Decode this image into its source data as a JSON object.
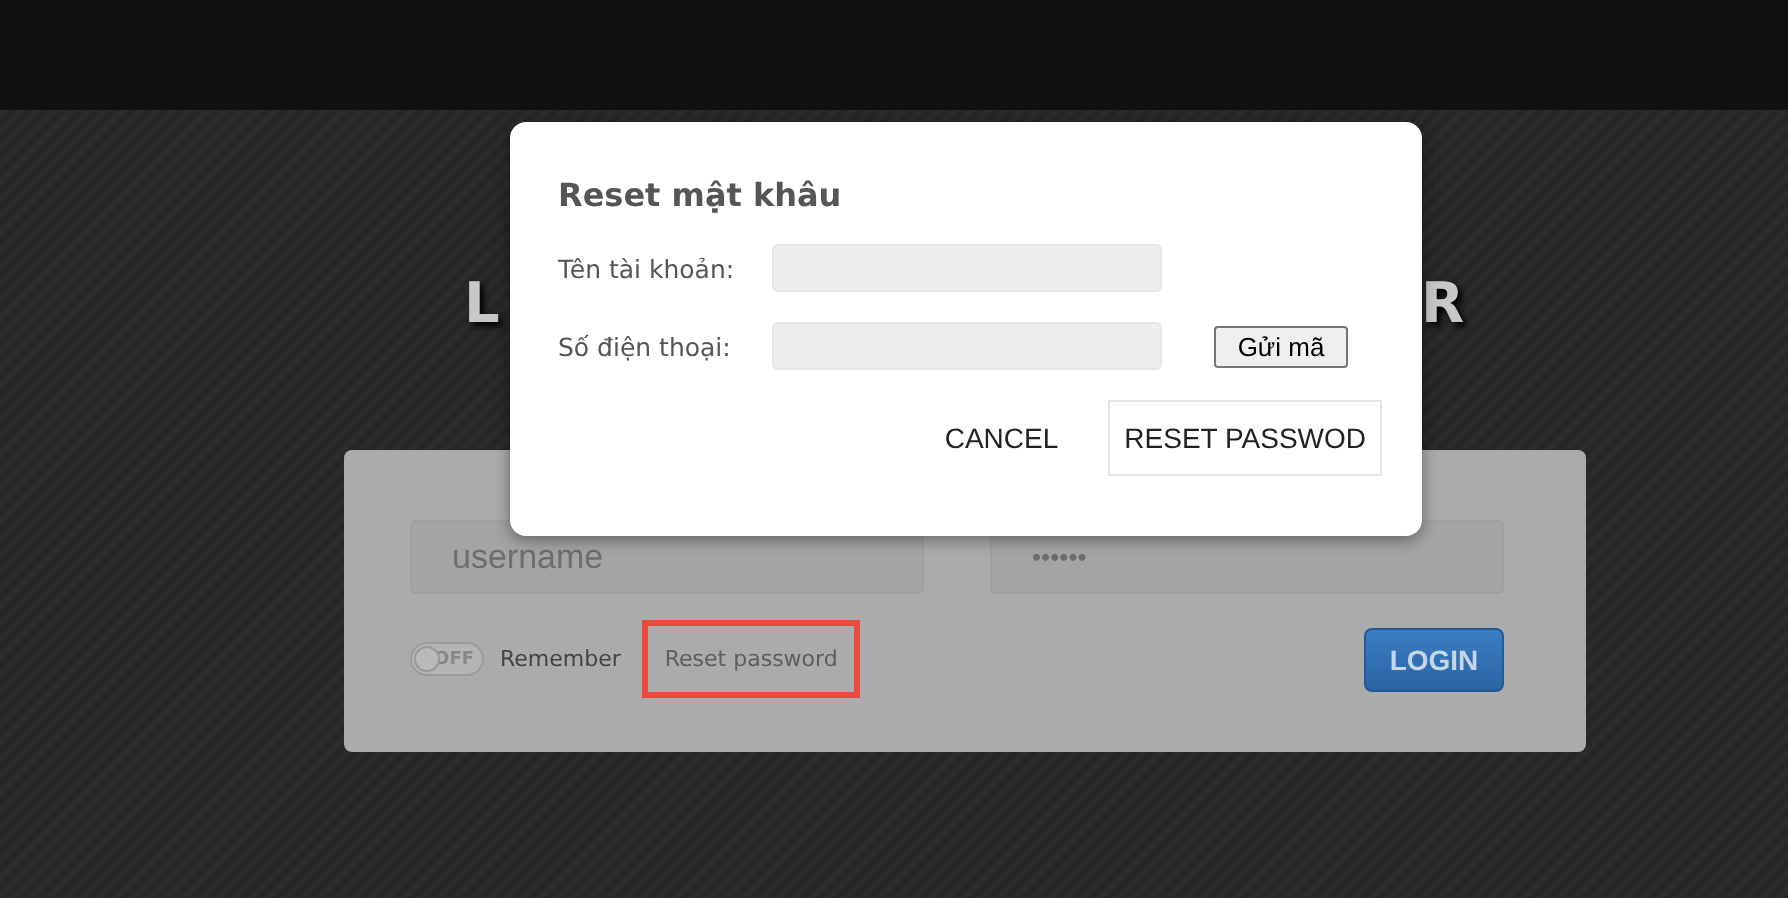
{
  "page_heading": {
    "visible_start": "L",
    "visible_end": "R"
  },
  "login_form": {
    "username": {
      "placeholder": "username"
    },
    "password": {
      "value": "••••••"
    },
    "remember": {
      "toggle_label": "OFF",
      "on": false,
      "label": "Remember"
    },
    "reset_link": {
      "label": "Reset password",
      "highlighted": true
    },
    "login_button": "LOGIN"
  },
  "dialog": {
    "title": "Reset mật khâu",
    "fields": [
      {
        "label": "Tên tài khoản:"
      },
      {
        "label": "Số điện thoại:",
        "button": "Gửi mã"
      }
    ],
    "actions": [
      {
        "label": "CANCEL",
        "kind": "flat"
      },
      {
        "label": "RESET PASSWOD",
        "kind": "outlined"
      }
    ]
  }
}
